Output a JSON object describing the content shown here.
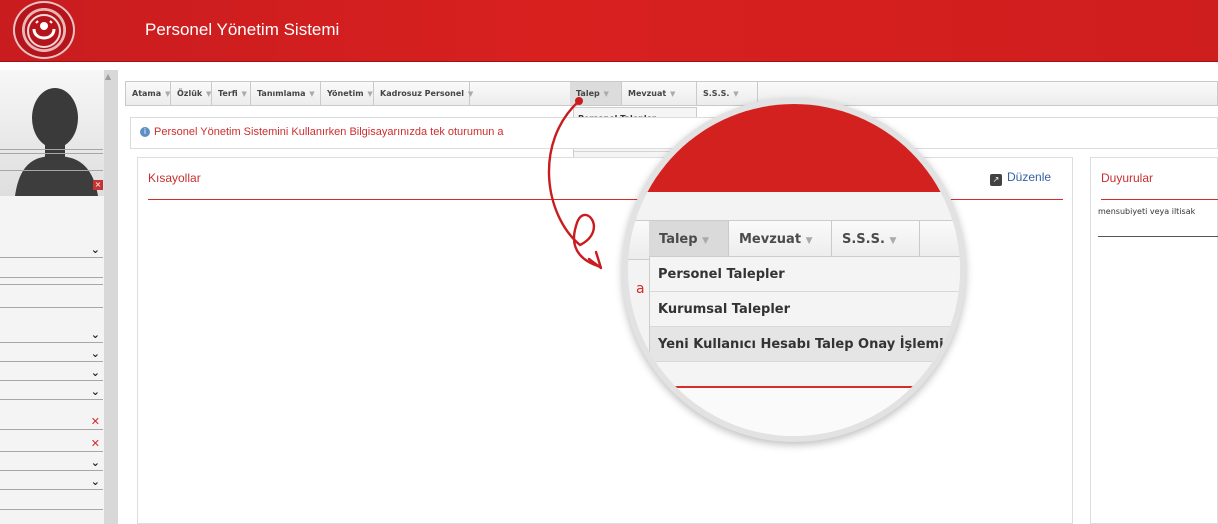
{
  "header": {
    "title": "Personel Yönetim Sistemi",
    "brand_color": "#d3211f"
  },
  "menu": {
    "items": [
      {
        "label": "Atama"
      },
      {
        "label": "Özlük"
      },
      {
        "label": "Terfi"
      },
      {
        "label": "Tanımlama"
      },
      {
        "label": "Yönetim"
      },
      {
        "label": "Kadrosuz Personel"
      },
      {
        "label": "Talep"
      },
      {
        "label": "Mevzuat"
      },
      {
        "label": "S.S.S."
      }
    ],
    "active": "Talep",
    "talep_dropdown": [
      "Personel Talepler",
      "Kurumsal Talepler",
      "Yeni Kullanıcı Hesabı Talep Onay İşlemi"
    ],
    "talep_dropdown_truncated_third": "Yeni Kullanıcı He"
  },
  "info_bar": {
    "text": "Personel Yönetim Sistemini Kullanırken Bilgisayarınızda tek oturumun a",
    "icon": "info-icon"
  },
  "shortcuts": {
    "title": "Kısayollar",
    "edit_label": "Düzenle",
    "edit_icon": "edit-icon"
  },
  "announcements": {
    "title": "Duyurular",
    "text": "mensubiyeti veya iltisak"
  },
  "magnifier": {
    "menu_items": [
      "Talep",
      "Mevzuat",
      "S.S.S."
    ],
    "red_fragment": "a"
  },
  "sidebar": {
    "close_icon": "close-icon",
    "controls": [
      "chevron-down-icon",
      "chevron-down-icon",
      "chevron-down-icon",
      "chevron-down-icon",
      "chevron-down-icon",
      "remove-icon",
      "remove-icon",
      "chevron-down-icon",
      "chevron-down-icon"
    ]
  }
}
